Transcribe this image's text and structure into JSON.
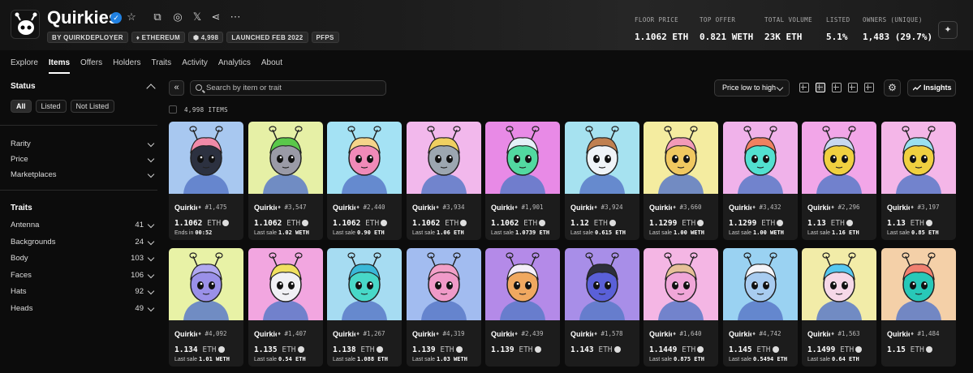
{
  "collection": {
    "name": "Quirkies",
    "chips": [
      "BY QUIRKDEPLOYER",
      "♦ ETHEREUM",
      "⬢ 4,998",
      "LAUNCHED FEB 2022",
      "PFPS"
    ]
  },
  "stats": [
    {
      "label": "FLOOR PRICE",
      "value": "1.1062 ETH"
    },
    {
      "label": "TOP OFFER",
      "value": "0.821 WETH"
    },
    {
      "label": "TOTAL VOLUME",
      "value": "23K ETH"
    },
    {
      "label": "LISTED",
      "value": "5.1%"
    },
    {
      "label": "OWNERS (UNIQUE)",
      "value": "1,483 (29.7%)"
    }
  ],
  "tabs": [
    "Explore",
    "Items",
    "Offers",
    "Holders",
    "Traits",
    "Activity",
    "Analytics",
    "About"
  ],
  "active_tab": "Items",
  "sidebar": {
    "status_title": "Status",
    "status_buttons": [
      "All",
      "Listed",
      "Not Listed"
    ],
    "filters": [
      "Rarity",
      "Price",
      "Marketplaces"
    ],
    "traits_title": "Traits",
    "traits": [
      {
        "name": "Antenna",
        "count": "41"
      },
      {
        "name": "Backgrounds",
        "count": "24"
      },
      {
        "name": "Body",
        "count": "103"
      },
      {
        "name": "Faces",
        "count": "106"
      },
      {
        "name": "Hats",
        "count": "92"
      },
      {
        "name": "Heads",
        "count": "49"
      }
    ]
  },
  "toolbar": {
    "search_placeholder": "Search by item or trait",
    "sort_label": "Price low to high",
    "insights_label": "Insights",
    "items_count": "4,998 ITEMS"
  },
  "icons": [
    "star-icon",
    "copy-icon",
    "globe-icon",
    "x-icon",
    "share-icon",
    "more-icon",
    "sparkle-icon",
    "search-icon",
    "gear-icon",
    "trend-icon",
    "grid-icon",
    "list-icon"
  ],
  "cards": [
    {
      "name": "Quirkies",
      "id": "#1,475",
      "price": "1.1062",
      "unit": "ETH",
      "sub_prefix": "Ends in",
      "sub_value": "00:52",
      "bg": "#a8c8f0",
      "skin": "#2c3140",
      "hair": "#f08aa8"
    },
    {
      "name": "Quirkies",
      "id": "#3,547",
      "price": "1.1062",
      "unit": "ETH",
      "sub_prefix": "Last sale",
      "sub_value": "1.02 WETH",
      "bg": "#e6f0a6",
      "skin": "#9a9aa6",
      "hair": "#5ac84a"
    },
    {
      "name": "Quirkies",
      "id": "#2,440",
      "price": "1.1062",
      "unit": "ETH",
      "sub_prefix": "Last sale",
      "sub_value": "0.90 ETH",
      "bg": "#a4e2f4",
      "skin": "#f08ab8",
      "hair": "#f5d48a"
    },
    {
      "name": "Quirkies",
      "id": "#3,934",
      "price": "1.1062",
      "unit": "ETH",
      "sub_prefix": "Last sale",
      "sub_value": "1.06 ETH",
      "bg": "#f2b8ec",
      "skin": "#9ca6b0",
      "hair": "#f0d060"
    },
    {
      "name": "Quirkies",
      "id": "#1,901",
      "price": "1.1062",
      "unit": "ETH",
      "sub_prefix": "Last sale",
      "sub_value": "1.0739 ETH",
      "bg": "#e88ae6",
      "skin": "#52d8a0",
      "hair": "#e6f0f8"
    },
    {
      "name": "Quirkies",
      "id": "#3,924",
      "price": "1.12",
      "unit": "ETH",
      "sub_prefix": "Last sale",
      "sub_value": "0.615 ETH",
      "bg": "#a6e2f0",
      "skin": "#f0f4f8",
      "hair": "#c08050"
    },
    {
      "name": "Quirkies",
      "id": "#3,660",
      "price": "1.1299",
      "unit": "ETH",
      "sub_prefix": "Last sale",
      "sub_value": "1.00 WETH",
      "bg": "#f4eca0",
      "skin": "#f0c860",
      "hair": "#f29ab8"
    },
    {
      "name": "Quirkies",
      "id": "#3,432",
      "price": "1.1299",
      "unit": "ETH",
      "sub_prefix": "Last sale",
      "sub_value": "1.00 WETH",
      "bg": "#f0b2ea",
      "skin": "#52e0d0",
      "hair": "#f08060"
    },
    {
      "name": "Quirkies",
      "id": "#2,296",
      "price": "1.13",
      "unit": "ETH",
      "sub_prefix": "Last sale",
      "sub_value": "1.16 ETH",
      "bg": "#f2a6e8",
      "skin": "#f0d040",
      "hair": "#c8d8f0"
    },
    {
      "name": "Quirkies",
      "id": "#3,197",
      "price": "1.13",
      "unit": "ETH",
      "sub_prefix": "Last sale",
      "sub_value": "0.85 ETH",
      "bg": "#f4b6e8",
      "skin": "#f0d040",
      "hair": "#9ae0f0"
    },
    {
      "name": "Quirkies",
      "id": "#4,092",
      "price": "1.134",
      "unit": "ETH",
      "sub_prefix": "Last sale",
      "sub_value": "1.01 WETH",
      "bg": "#e8f2a6",
      "skin": "#9a90e8",
      "hair": "#b0a8f0"
    },
    {
      "name": "Quirkies",
      "id": "#1,407",
      "price": "1.135",
      "unit": "ETH",
      "sub_prefix": "Last sale",
      "sub_value": "0.54 ETH",
      "bg": "#f2a6e0",
      "skin": "#f0f0f4",
      "hair": "#f0e060"
    },
    {
      "name": "Quirkies",
      "id": "#1,267",
      "price": "1.138",
      "unit": "ETH",
      "sub_prefix": "Last sale",
      "sub_value": "1.088 ETH",
      "bg": "#a6dcf2",
      "skin": "#48d8c8",
      "hair": "#3ab8d8"
    },
    {
      "name": "Quirkies",
      "id": "#4,319",
      "price": "1.139",
      "unit": "ETH",
      "sub_prefix": "Last sale",
      "sub_value": "1.03 WETH",
      "bg": "#a2bcf0",
      "skin": "#f09ac8",
      "hair": "#f2a0c8"
    },
    {
      "name": "Quirkies",
      "id": "#2,439",
      "price": "1.139",
      "unit": "ETH",
      "sub_prefix": "",
      "sub_value": "",
      "bg": "#b48ae8",
      "skin": "#f0a860",
      "hair": "#f4eef8"
    },
    {
      "name": "Quirkies",
      "id": "#1,578",
      "price": "1.143",
      "unit": "ETH",
      "sub_prefix": "",
      "sub_value": "",
      "bg": "#a88ee8",
      "skin": "#5a60d8",
      "hair": "#2d2f3a"
    },
    {
      "name": "Quirkies",
      "id": "#1,640",
      "price": "1.1449",
      "unit": "ETH",
      "sub_prefix": "Last sale",
      "sub_value": "0.875 ETH",
      "bg": "#f4b6e4",
      "skin": "#f0a6d8",
      "hair": "#e6c098"
    },
    {
      "name": "Quirkies",
      "id": "#4,742",
      "price": "1.145",
      "unit": "ETH",
      "sub_prefix": "Last sale",
      "sub_value": "0.5494 ETH",
      "bg": "#9ad2f2",
      "skin": "#a8ccf0",
      "hair": "#f4f4f8"
    },
    {
      "name": "Quirkies",
      "id": "#1,563",
      "price": "1.1499",
      "unit": "ETH",
      "sub_prefix": "Last sale",
      "sub_value": "0.64 ETH",
      "bg": "#f2eca8",
      "skin": "#f6d8e8",
      "hair": "#58c8f0"
    },
    {
      "name": "Quirkies",
      "id": "#1,484",
      "price": "1.15",
      "unit": "ETH",
      "sub_prefix": "",
      "sub_value": "",
      "bg": "#f4d0a8",
      "skin": "#28c8b8",
      "hair": "#f08070"
    }
  ]
}
